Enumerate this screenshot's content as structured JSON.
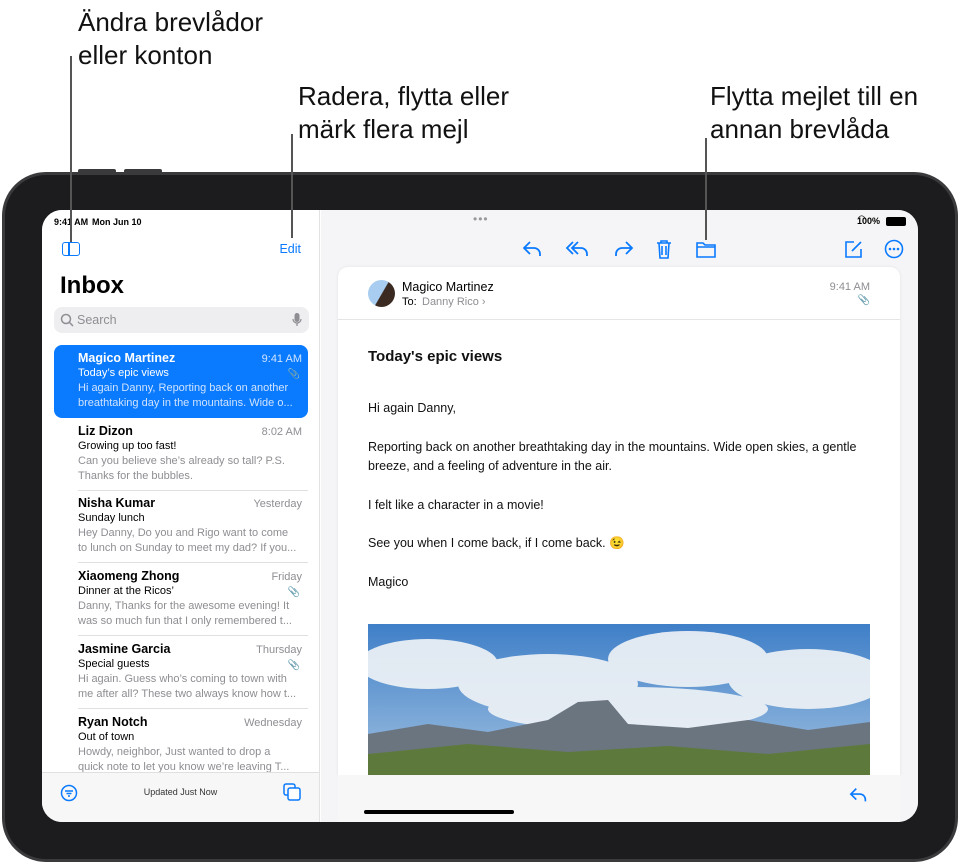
{
  "callouts": {
    "mailboxes": "Ändra brevlådor\neller konton",
    "edit": "Radera, flytta eller\nmärk flera mejl",
    "move": "Flytta mejlet till en\nannan brevlåda"
  },
  "status": {
    "time": "9:41 AM",
    "date": "Mon Jun 10",
    "battery": "100%"
  },
  "sidebar": {
    "edit_label": "Edit",
    "title": "Inbox",
    "search_placeholder": "Search",
    "footer_status": "Updated Just Now",
    "messages": [
      {
        "sender": "Magico Martinez",
        "time": "9:41 AM",
        "subject": "Today’s epic views",
        "preview1": "Hi again Danny, Reporting back on another",
        "preview2": "breathtaking day in the mountains. Wide o...",
        "attachment": true,
        "selected": true
      },
      {
        "sender": "Liz Dizon",
        "time": "8:02 AM",
        "subject": "Growing up too fast!",
        "preview1": "Can you believe she’s already so tall? P.S.",
        "preview2": "Thanks for the bubbles.",
        "attachment": false
      },
      {
        "sender": "Nisha Kumar",
        "time": "Yesterday",
        "subject": "Sunday lunch",
        "preview1": "Hey Danny, Do you and Rigo want to come",
        "preview2": "to lunch on Sunday to meet my dad? If you...",
        "attachment": false
      },
      {
        "sender": "Xiaomeng Zhong",
        "time": "Friday",
        "subject": "Dinner at the Ricos’",
        "preview1": "Danny, Thanks for the awesome evening! It",
        "preview2": "was so much fun that I only remembered t...",
        "attachment": true
      },
      {
        "sender": "Jasmine Garcia",
        "time": "Thursday",
        "subject": "Special guests",
        "preview1": "Hi again. Guess who’s coming to town with",
        "preview2": "me after all? These two always know how t...",
        "attachment": true
      },
      {
        "sender": "Ryan Notch",
        "time": "Wednesday",
        "subject": "Out of town",
        "preview1": "Howdy, neighbor, Just wanted to drop a",
        "preview2": "quick note to let you know we’re leaving T...",
        "attachment": false
      }
    ]
  },
  "message": {
    "sender": "Magico Martinez",
    "to_label": "To:",
    "to": "Danny Rico ›",
    "time": "9:41 AM",
    "subject": "Today's epic views",
    "paragraphs": [
      "Hi again Danny,",
      "Reporting back on another breathtaking day in the mountains. Wide open skies, a gentle breeze, and a feeling of adventure in the air.",
      "I felt like a character in a movie!",
      "See you when I come back, if I come back. 😉",
      "Magico"
    ]
  },
  "toolbar_icons": [
    "reply-icon",
    "reply-all-icon",
    "forward-icon",
    "trash-icon",
    "folder-icon",
    "compose-icon",
    "more-icon"
  ],
  "colors": {
    "accent": "#0a7aff"
  }
}
